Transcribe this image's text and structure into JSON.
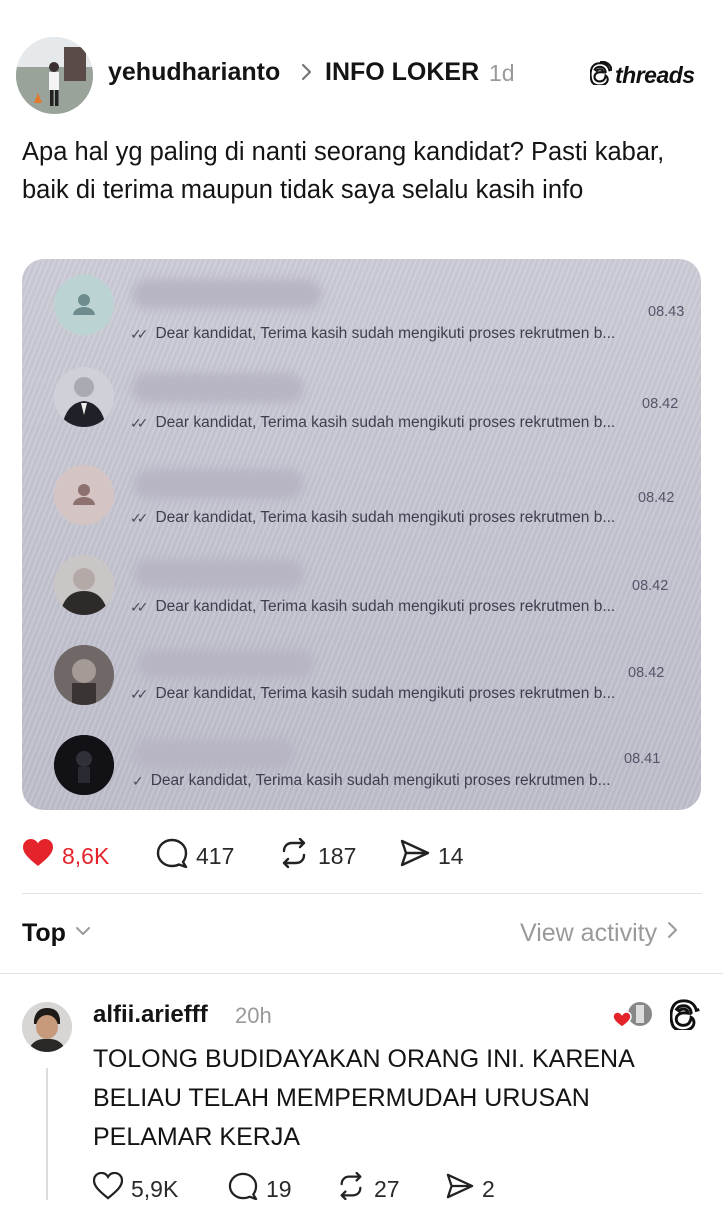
{
  "post": {
    "username": "yehudharianto",
    "topic": "INFO LOKER",
    "time": "1d",
    "brand": "threads",
    "text": "Apa hal yg paling di nanti seorang kandidat? Pasti kabar, baik di terima maupun tidak saya selalu kasih info"
  },
  "chat_list": [
    {
      "time": "08.43",
      "message": "Dear kandidat, Terima kasih sudah mengikuti proses rekrutmen b...",
      "ticks": "✓✓"
    },
    {
      "time": "08.42",
      "message": "Dear kandidat, Terima kasih sudah mengikuti proses rekrutmen b...",
      "ticks": "✓✓"
    },
    {
      "time": "08.42",
      "message": "Dear kandidat, Terima kasih sudah mengikuti proses rekrutmen b...",
      "ticks": "✓✓"
    },
    {
      "time": "08.42",
      "message": "Dear kandidat, Terima kasih sudah mengikuti proses rekrutmen b...",
      "ticks": "✓✓"
    },
    {
      "time": "08.42",
      "message": "Dear kandidat, Terima kasih sudah mengikuti proses rekrutmen b...",
      "ticks": "✓✓"
    },
    {
      "time": "08.41",
      "message": "Dear kandidat, Terima kasih sudah mengikuti proses rekrutmen b...",
      "ticks": "✓"
    }
  ],
  "actions": {
    "likes": "8,6K",
    "replies": "417",
    "reposts": "187",
    "shares": "14"
  },
  "sort": {
    "label": "Top",
    "view_activity": "View activity"
  },
  "reply": {
    "username": "alfii.ariefff",
    "time": "20h",
    "text": "TOLONG BUDIDAYAKAN ORANG INI. KARENA BELIAU TELAH MEMPERMUDAH URUSAN PELAMAR KERJA",
    "likes": "5,9K",
    "replies": "19",
    "reposts": "27",
    "shares": "2"
  },
  "colors": {
    "like_red": "#e5232b",
    "muted": "#9a9a9a",
    "text": "#141414"
  },
  "icons": [
    "heart-icon",
    "comment-icon",
    "repost-icon",
    "share-icon",
    "chevron-right-icon",
    "chevron-down-icon",
    "threads-logo-icon"
  ]
}
